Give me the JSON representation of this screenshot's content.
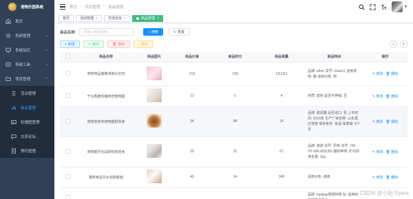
{
  "app": {
    "title": "宠物乐园系统"
  },
  "sidebar": {
    "items": [
      {
        "label": "首页"
      },
      {
        "label": "系统管理"
      },
      {
        "label": "系统监控"
      },
      {
        "label": "系统工具"
      },
      {
        "label": "项目管理"
      }
    ],
    "subitems": [
      {
        "label": "活动管理"
      },
      {
        "label": "商品管理"
      },
      {
        "label": "轮播图管理"
      },
      {
        "label": "交流论坛"
      },
      {
        "label": "预约管理"
      }
    ]
  },
  "navbar": {
    "breadcrumb": [
      "首页",
      "项目管理",
      "商品管理"
    ]
  },
  "tags": [
    {
      "label": "首页"
    },
    {
      "label": "活动管理"
    },
    {
      "label": "交流论坛"
    },
    {
      "label": "商品管理"
    }
  ],
  "search": {
    "label": "商品名称",
    "placeholder": "请输入商品名称",
    "search_btn": "搜索",
    "reset_btn": "重置"
  },
  "actions": {
    "add": "新增",
    "edit": "修改",
    "delete": "删除",
    "export": "导出"
  },
  "table": {
    "headers": [
      "商品名称",
      "商品图片",
      "商品价格",
      "商品积分",
      "商品销量",
      "商品特点",
      "操作"
    ],
    "op_edit": "修改",
    "op_delete": "删除",
    "rows": [
      {
        "name": "宠物用品猫粮双碗太空包",
        "price": "213",
        "points": "100",
        "sales": "1111111",
        "feature": "品牌: other 货号: zhao01 适用宠物: 猫 适用对象: 狗"
      },
      {
        "name": "干鸟香脆鸡胸肉增重鸭腿",
        "price": "12",
        "points": "5",
        "sales": "4",
        "feature": "材质: 其他 是否可伸缩: 否"
      },
      {
        "name": "宠物零食鸡肉鸭腿狗零食",
        "price": "34",
        "points": "98",
        "sales": "24",
        "feature": "品牌: 滋润猫 是否进口: 否 上市时间: 2019年 生产厂家名称: 山东嘉达宠物 保存条件: 常温 保质期: 6个月"
      },
      {
        "name": "宠物磨牙玩具耐咬狗零食",
        "price": "29",
        "points": "22",
        "sales": "67",
        "feature": "品牌: 驰骋 货号: 原味 货号: YM-YP-WR-MSCBS 猫砂种类: 矿石砂 净含量: 1kg"
      },
      {
        "name": "猫咪食盆饮水双碗套装",
        "price": "45",
        "points": "34",
        "sales": "349",
        "feature": "适用对象: 通用"
      },
      {
        "name": "",
        "price": "",
        "points": "",
        "sales": "",
        "feature": "品牌: tripdog/驰骋特惠 标: 鼠鸭纪宠物冻干零食"
      }
    ]
  },
  "watermark": "CSDN @小赵与java",
  "colors": {
    "sidebar_bg": "#304156",
    "primary": "#1890ff",
    "tag_active": "#42b983"
  }
}
